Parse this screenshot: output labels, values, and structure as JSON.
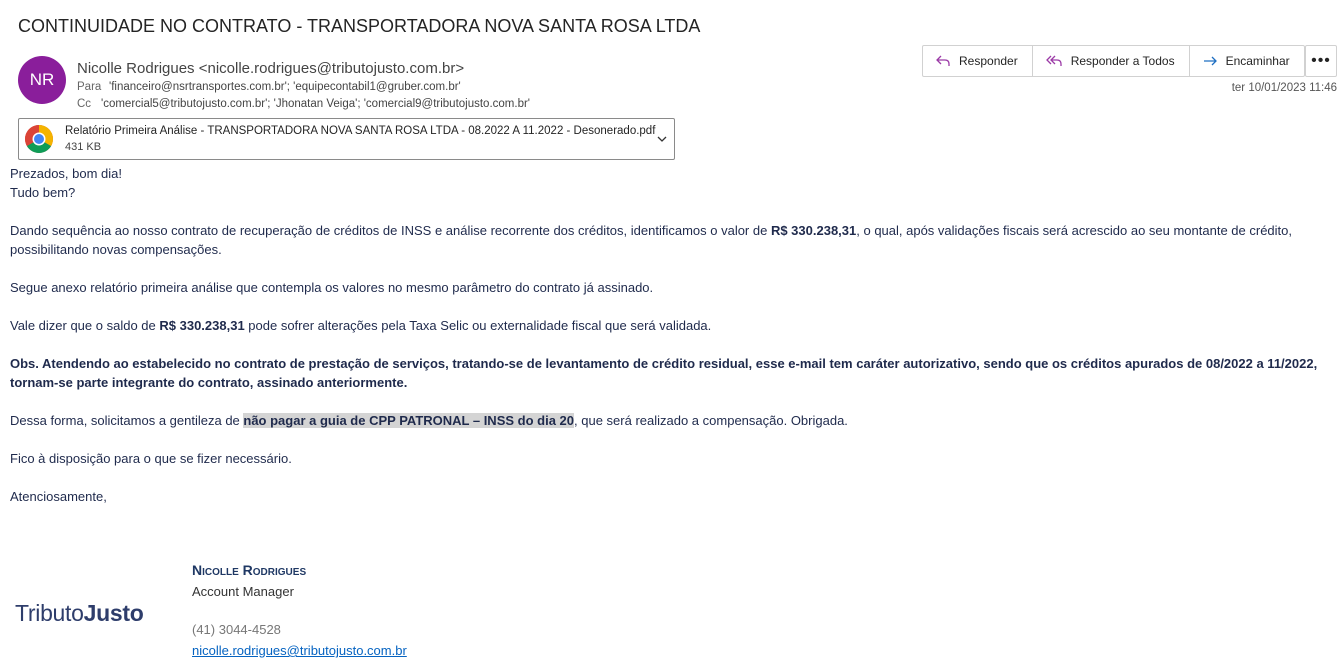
{
  "subject": "CONTINUIDADE NO CONTRATO - TRANSPORTADORA NOVA SANTA ROSA LTDA",
  "sender": {
    "initials": "NR",
    "display": "Nicolle Rodrigues <nicolle.rodrigues@tributojusto.com.br>",
    "avatar_color": "#8a1e9b"
  },
  "recipients": {
    "to_label": "Para",
    "to": "'financeiro@nsrtransportes.com.br'; 'equipecontabil1@gruber.com.br'",
    "cc_label": "Cc",
    "cc": "'comercial5@tributojusto.com.br'; 'Jhonatan Veiga'; 'comercial9@tributojusto.com.br'"
  },
  "actions": {
    "reply": "Responder",
    "reply_all": "Responder a Todos",
    "forward": "Encaminhar",
    "more": "•••"
  },
  "date": "ter 10/01/2023 11:46",
  "attachment": {
    "name": "Relatório Primeira Análise - TRANSPORTADORA NOVA SANTA ROSA LTDA - 08.2022 A 11.2022 - Desonerado.pdf",
    "size": "431 KB",
    "icon": "chrome-icon"
  },
  "body": {
    "greeting1": "Prezados, bom dia!",
    "greeting2": "Tudo bem?",
    "p1_a": "Dando sequência ao nosso contrato de recuperação de créditos de INSS e análise recorrente dos créditos, identificamos o valor de ",
    "p1_amount": "R$ 330.238,31",
    "p1_b": ", o qual, após validações fiscais será acrescido ao seu montante de crédito, possibilitando novas compensações.",
    "p2": "Segue anexo relatório primeira análise que contempla os valores no mesmo parâmetro do contrato já assinado.",
    "p3_a": "Vale dizer que o saldo de ",
    "p3_amount": "R$ 330.238,31",
    "p3_b": " pode sofrer alterações pela Taxa Selic ou externalidade fiscal que será validada.",
    "obs": "Obs. Atendendo ao estabelecido no contrato de prestação de serviços, tratando-se de levantamento de crédito residual, esse e-mail tem caráter autorizativo, sendo que os créditos apurados de 08/2022 a 11/2022, tornam-se parte integrante do contrato, assinado anteriormente.",
    "p4_a": "Dessa forma, solicitamos a gentileza de ",
    "p4_highlight": "não pagar a guia de CPP PATRONAL – INSS do dia 20",
    "p4_b": ", que será realizado a compensação. Obrigada.",
    "p5": "Fico à disposição para o que se fizer necessário.",
    "closing": "Atenciosamente,"
  },
  "signature": {
    "logo_part1": "Tributo",
    "logo_part2": "Justo",
    "name": "Nicolle Rodrigues",
    "title": "Account Manager",
    "phone": "(41) 3044-4528",
    "email": "nicolle.rodrigues@tributojusto.com.br"
  }
}
